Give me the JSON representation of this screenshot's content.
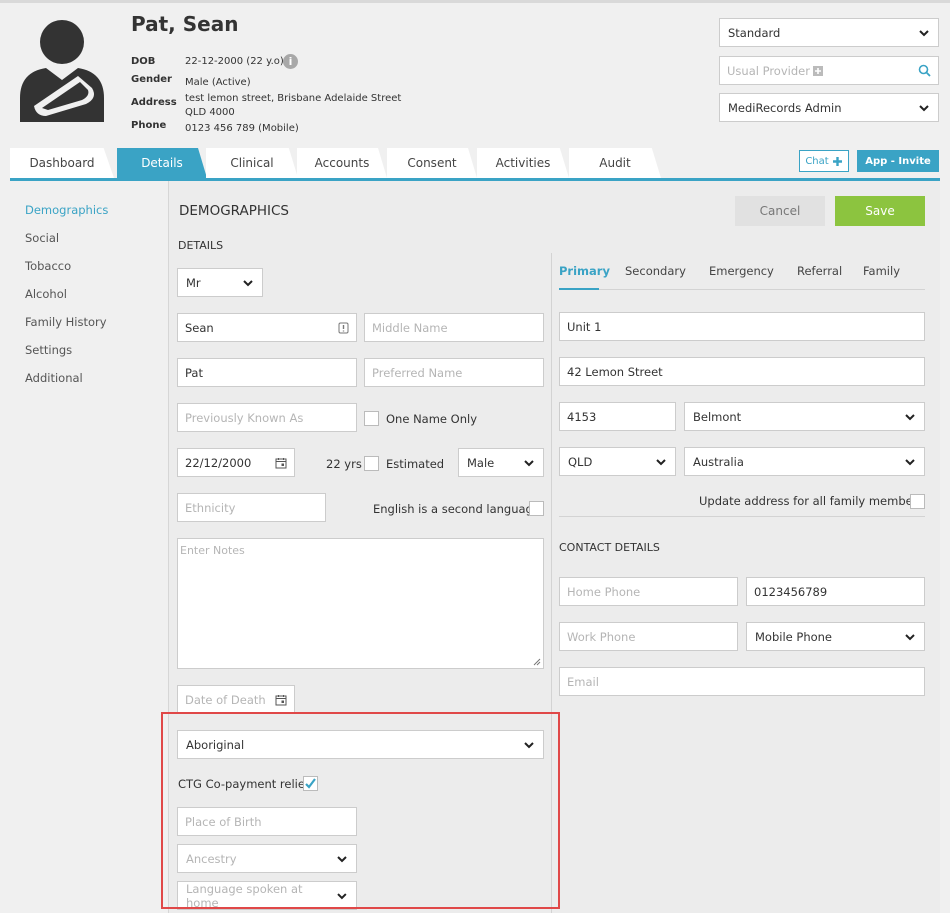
{
  "patient": {
    "name": "Pat, Sean",
    "dob_label": "DOB",
    "dob_value": "22-12-2000 (22 y.o)",
    "gender_label": "Gender",
    "gender_value": "Male (Active)",
    "address_label": "Address",
    "address_line1": "test lemon street, Brisbane Adelaide Street",
    "address_line2": "QLD 4000",
    "phone_label": "Phone",
    "phone_value": "0123 456 789 (Mobile)"
  },
  "header_right": {
    "view_select": "Standard",
    "usual_provider_placeholder": "Usual Provider",
    "user_select": "MediRecords Admin"
  },
  "tabs": [
    {
      "label": "Dashboard"
    },
    {
      "label": "Details"
    },
    {
      "label": "Clinical"
    },
    {
      "label": "Accounts"
    },
    {
      "label": "Consent"
    },
    {
      "label": "Activities"
    },
    {
      "label": "Audit"
    }
  ],
  "actions": {
    "chat_label": "Chat",
    "invite_label": "App - Invite",
    "cancel_label": "Cancel",
    "save_label": "Save"
  },
  "sidenav": [
    {
      "label": "Demographics"
    },
    {
      "label": "Social"
    },
    {
      "label": "Tobacco"
    },
    {
      "label": "Alcohol"
    },
    {
      "label": "Family History"
    },
    {
      "label": "Settings"
    },
    {
      "label": "Additional"
    }
  ],
  "form": {
    "section_title": "DEMOGRAPHICS",
    "details_heading": "DETAILS",
    "title_value": "Mr",
    "first_name": "Sean",
    "middle_name_placeholder": "Middle Name",
    "last_name": "Pat",
    "preferred_name_placeholder": "Preferred Name",
    "previously_known_placeholder": "Previously Known As",
    "one_name_only_label": "One Name Only",
    "dob_value": "22/12/2000",
    "age_text": "22 yrs",
    "estimated_label": "Estimated",
    "sex_value": "Male",
    "ethnicity_placeholder": "Ethnicity",
    "english_second_label": "English is a second language",
    "notes_placeholder": "Enter Notes",
    "date_of_death_placeholder": "Date of Death",
    "indigenous_value": "Aboriginal",
    "ctg_label": "CTG Co-payment relief",
    "place_of_birth_placeholder": "Place of Birth",
    "ancestry_placeholder": "Ancestry",
    "language_placeholder": "Language spoken at home"
  },
  "address": {
    "subtabs": [
      {
        "label": "Primary"
      },
      {
        "label": "Secondary"
      },
      {
        "label": "Emergency"
      },
      {
        "label": "Referral"
      },
      {
        "label": "Family"
      }
    ],
    "line1": "Unit 1",
    "line2": "42 Lemon Street",
    "postcode": "4153",
    "suburb": "Belmont",
    "state": "QLD",
    "country": "Australia",
    "update_family_label": "Update address for all family members"
  },
  "contact": {
    "heading": "CONTACT DETAILS",
    "home_phone_placeholder": "Home Phone",
    "mobile_value": "0123456789",
    "work_phone_placeholder": "Work Phone",
    "phone_type_value": "Mobile Phone",
    "email_placeholder": "Email"
  }
}
